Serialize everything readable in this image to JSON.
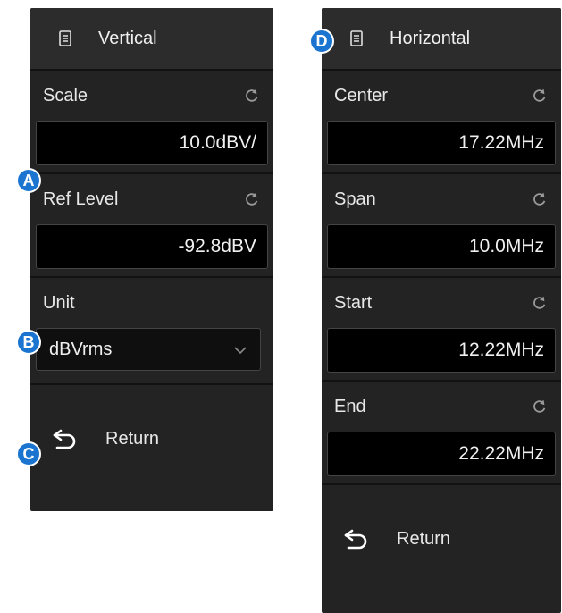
{
  "vertical": {
    "title": "Vertical",
    "scale": {
      "label": "Scale",
      "value": "10.0dBV/"
    },
    "ref_level": {
      "label": "Ref Level",
      "value": "-92.8dBV"
    },
    "unit": {
      "label": "Unit",
      "value": "dBVrms"
    },
    "return_label": "Return"
  },
  "horizontal": {
    "title": "Horizontal",
    "center": {
      "label": "Center",
      "value": "17.22MHz"
    },
    "span": {
      "label": "Span",
      "value": "10.0MHz"
    },
    "start": {
      "label": "Start",
      "value": "12.22MHz"
    },
    "end": {
      "label": "End",
      "value": "22.22MHz"
    },
    "return_label": "Return"
  },
  "callouts": {
    "a": "A",
    "b": "B",
    "c": "C",
    "d": "D"
  },
  "colors": {
    "panel_bg": "#232323",
    "callout": "#1b75d0",
    "value_bg": "#000000"
  }
}
